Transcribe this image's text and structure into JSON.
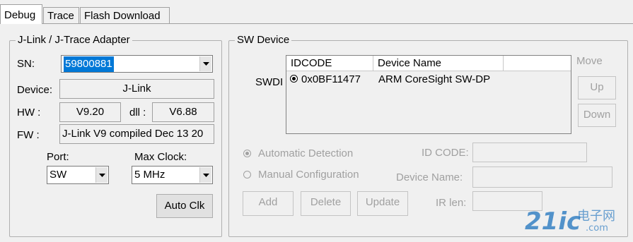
{
  "tabs": [
    {
      "label": "Debug",
      "active": true
    },
    {
      "label": "Trace",
      "active": false
    },
    {
      "label": "Flash Download",
      "active": false
    }
  ],
  "adapter": {
    "title": "J-Link / J-Trace Adapter",
    "sn_label": "SN:",
    "sn_value": "59800881",
    "device_label": "Device:",
    "device_value": "J-Link",
    "hw_label": "HW :",
    "hw_value": "V9.20",
    "dll_label": "dll :",
    "dll_value": "V6.88",
    "fw_label": "FW :",
    "fw_value": "J-Link V9 compiled Dec 13 20",
    "port_label": "Port:",
    "port_value": "SW",
    "clock_label": "Max Clock:",
    "clock_value": "5 MHz",
    "auto_clk_button": "Auto Clk"
  },
  "sw_device": {
    "title": "SW Device",
    "swdi_label": "SWDI",
    "columns": [
      "IDCODE",
      "Device Name"
    ],
    "rows": [
      {
        "idcode": "0x0BF11477",
        "device_name": "ARM CoreSight SW-DP",
        "selected": true
      }
    ],
    "move_label": "Move",
    "up_button": "Up",
    "down_button": "Down",
    "auto_detect_label": "Automatic Detection",
    "manual_config_label": "Manual Configuration",
    "id_code_label": "ID CODE:",
    "device_name_label": "Device Name:",
    "ir_len_label": "IR len:",
    "add_button": "Add",
    "delete_button": "Delete",
    "update_button": "Update"
  },
  "watermark": {
    "text": "21ic",
    "subtext": "电子网",
    "url": ".com"
  },
  "colors": {
    "selection": "#0078d7",
    "disabled_text": "#a0a0a0",
    "watermark_blue": "#1e73be"
  }
}
